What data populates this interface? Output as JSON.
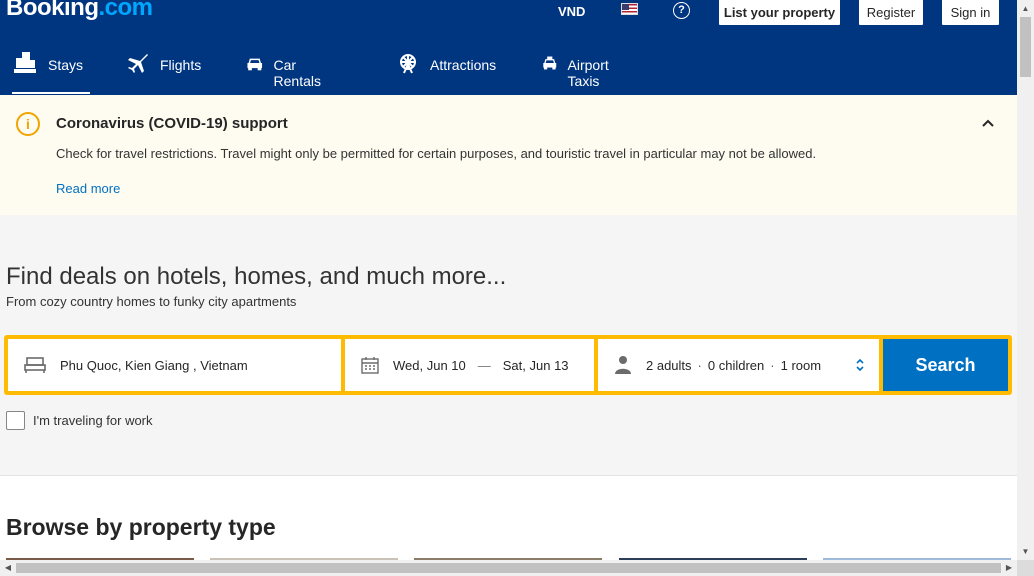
{
  "header": {
    "logo_main": "Booking",
    "logo_dot": ".",
    "logo_tld": "com",
    "currency": "VND",
    "help_glyph": "?",
    "list_property": "List your property",
    "register": "Register",
    "sign_in": "Sign in"
  },
  "nav": {
    "items": [
      {
        "label": "Stays",
        "icon": "bed-building-icon",
        "active": true
      },
      {
        "label": "Flights",
        "icon": "plane-icon"
      },
      {
        "label": "Car Rentals",
        "icon": "car-icon"
      },
      {
        "label": "Attractions",
        "icon": "ferris-wheel-icon"
      },
      {
        "label": "Airport Taxis",
        "icon": "taxi-icon"
      }
    ]
  },
  "banner": {
    "icon_glyph": "i",
    "title": "Coronavirus (COVID-19) support",
    "text": "Check for travel restrictions. Travel might only be permitted for certain purposes, and touristic travel in particular may not be allowed.",
    "link": "Read more"
  },
  "hero": {
    "title": "Find deals on hotels, homes, and much more...",
    "subtitle": "From cozy country homes to funky city apartments"
  },
  "search": {
    "destination": "Phu Quoc, Kien Giang , Vietnam",
    "checkin": "Wed, Jun 10",
    "dash": "—",
    "checkout": "Sat, Jun 13",
    "adults": "2 adults",
    "children": "0 children",
    "rooms": "1 room",
    "sep": "·",
    "button": "Search"
  },
  "work": {
    "label": "I'm traveling for work"
  },
  "browse": {
    "title": "Browse by property type"
  },
  "colors": {
    "brand_blue": "#003580",
    "search_yellow": "#febb02",
    "link_blue": "#0071c2",
    "warning_orange": "#f0a500"
  }
}
